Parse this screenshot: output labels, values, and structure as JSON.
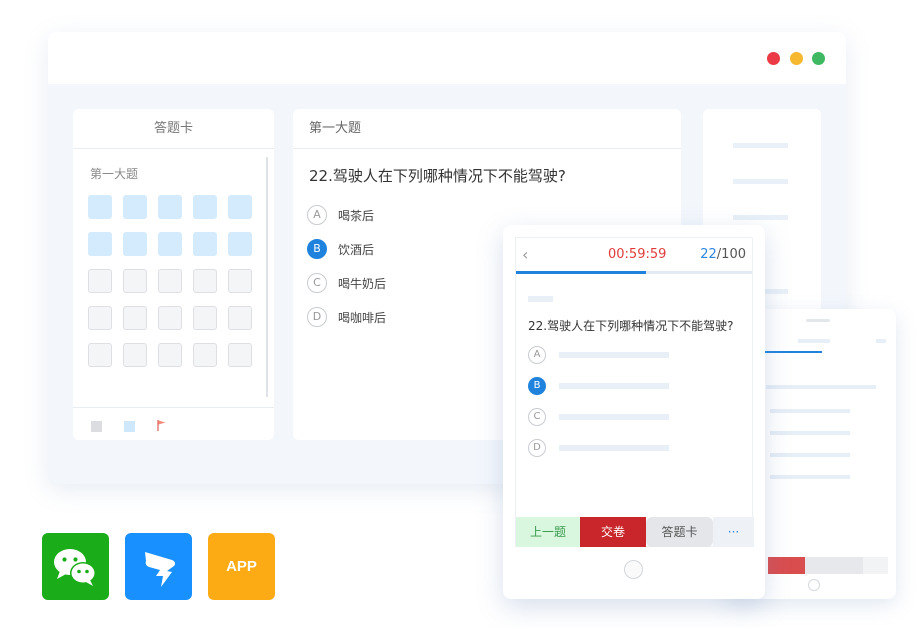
{
  "window": {
    "controls": [
      "close",
      "minimize",
      "maximize"
    ],
    "colors": {
      "close": "#ea3b47",
      "minimize": "#f5b82e",
      "maximize": "#3fb863"
    }
  },
  "answer_card": {
    "title": "答题卡",
    "section": "第一大题",
    "answered_count": 10,
    "unanswered_count": 15,
    "legend": [
      "unanswered-square",
      "answered-square",
      "flag-icon"
    ]
  },
  "question_panel": {
    "section": "第一大题",
    "question": "22.驾驶人在下列哪种情况下不能驾驶?",
    "options": [
      {
        "letter": "A",
        "text": "喝茶后",
        "selected": false
      },
      {
        "letter": "B",
        "text": "饮酒后",
        "selected": true
      },
      {
        "letter": "C",
        "text": "喝牛奶后",
        "selected": false
      },
      {
        "letter": "D",
        "text": "喝咖啡后",
        "selected": false
      }
    ]
  },
  "mobile": {
    "back_icon": "chevron-left-icon",
    "timer": "00:59:59",
    "progress": {
      "current": "22",
      "total": "/100",
      "fraction": 0.55
    },
    "question": "22.驾驶人在下列哪种情况下不能驾驶?",
    "options": [
      {
        "letter": "A",
        "selected": false
      },
      {
        "letter": "B",
        "selected": true
      },
      {
        "letter": "C",
        "selected": false
      },
      {
        "letter": "D",
        "selected": false
      }
    ],
    "buttons": {
      "prev": "上一题",
      "submit": "交卷",
      "card": "答题卡",
      "more": "···"
    }
  },
  "platforms": [
    {
      "name": "wechat-icon",
      "label": ""
    },
    {
      "name": "dingtalk-icon",
      "label": ""
    },
    {
      "name": "app-icon",
      "label": "APP"
    }
  ],
  "colors": {
    "accent": "#1f83dd",
    "danger": "#c8262a",
    "timer": "#e23b3b",
    "wechat": "#1aad19",
    "dingtalk": "#1890ff",
    "app": "#fdab15"
  }
}
